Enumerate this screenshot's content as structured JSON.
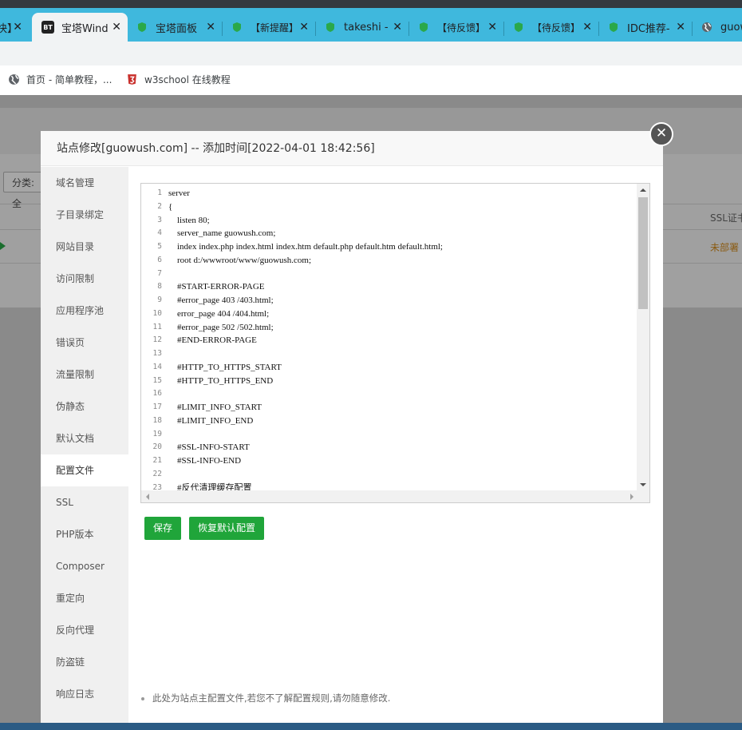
{
  "browser": {
    "tabs": [
      {
        "title": "快】",
        "icon": "none",
        "active": false
      },
      {
        "title": "宝塔Wind",
        "icon": "bt-logo-icon",
        "active": true
      },
      {
        "title": "宝塔面板",
        "icon": "green-shield-icon",
        "active": false
      },
      {
        "title": "【新提醒】",
        "icon": "green-shield-icon",
        "active": false
      },
      {
        "title": "takeshi -",
        "icon": "green-shield-icon",
        "active": false
      },
      {
        "title": "【待反馈】",
        "icon": "green-shield-icon",
        "active": false
      },
      {
        "title": "【待反馈】",
        "icon": "green-shield-icon",
        "active": false
      },
      {
        "title": "IDC推荐-",
        "icon": "green-shield-icon",
        "active": false
      },
      {
        "title": "guow",
        "icon": "globe-icon",
        "active": false
      }
    ],
    "bt_logo_text": "BT",
    "close_glyph": "✕",
    "bookmarks": [
      {
        "label": "首页 - 简单教程，...",
        "icon": "globe-icon"
      },
      {
        "label": "w3school 在线教程",
        "icon": "w3school-icon"
      }
    ]
  },
  "background_page": {
    "filter_label": "分类: 全",
    "ssl_header": "SSL证书",
    "ssl_status": "未部署",
    "status_color": "#b06d10"
  },
  "dialog": {
    "title": "站点修改[guowush.com] -- 添加时间[2022-04-01 18:42:56]",
    "close_glyph": "✕",
    "sidebar": [
      {
        "label": "域名管理",
        "active": false
      },
      {
        "label": "子目录绑定",
        "active": false
      },
      {
        "label": "网站目录",
        "active": false
      },
      {
        "label": "访问限制",
        "active": false
      },
      {
        "label": "应用程序池",
        "active": false
      },
      {
        "label": "错误页",
        "active": false
      },
      {
        "label": "流量限制",
        "active": false
      },
      {
        "label": "伪静态",
        "active": false
      },
      {
        "label": "默认文档",
        "active": false
      },
      {
        "label": "配置文件",
        "active": true
      },
      {
        "label": "SSL",
        "active": false
      },
      {
        "label": "PHP版本",
        "active": false
      },
      {
        "label": "Composer",
        "active": false
      },
      {
        "label": "重定向",
        "active": false
      },
      {
        "label": "反向代理",
        "active": false
      },
      {
        "label": "防盗链",
        "active": false
      },
      {
        "label": "响应日志",
        "active": false
      }
    ],
    "editor": {
      "lines": [
        "server",
        "{",
        "    listen 80;",
        "    server_name guowush.com;",
        "    index index.php index.html index.htm default.php default.htm default.html;",
        "    root d:/wwwroot/www/guowush.com;",
        "",
        "    #START-ERROR-PAGE",
        "    #error_page 403 /403.html;",
        "    error_page 404 /404.html;",
        "    #error_page 502 /502.html;",
        "    #END-ERROR-PAGE",
        "",
        "    #HTTP_TO_HTTPS_START",
        "    #HTTP_TO_HTTPS_END",
        "",
        "    #LIMIT_INFO_START",
        "    #LIMIT_INFO_END",
        "",
        "    #SSL-INFO-START",
        "    #SSL-INFO-END",
        "",
        "    #反代清理缓存配置"
      ]
    },
    "buttons": {
      "save": "保存",
      "restore": "恢复默认配置"
    },
    "note": "此处为站点主配置文件,若您不了解配置规则,请勿随意修改.",
    "accent_color": "#20a53a"
  }
}
